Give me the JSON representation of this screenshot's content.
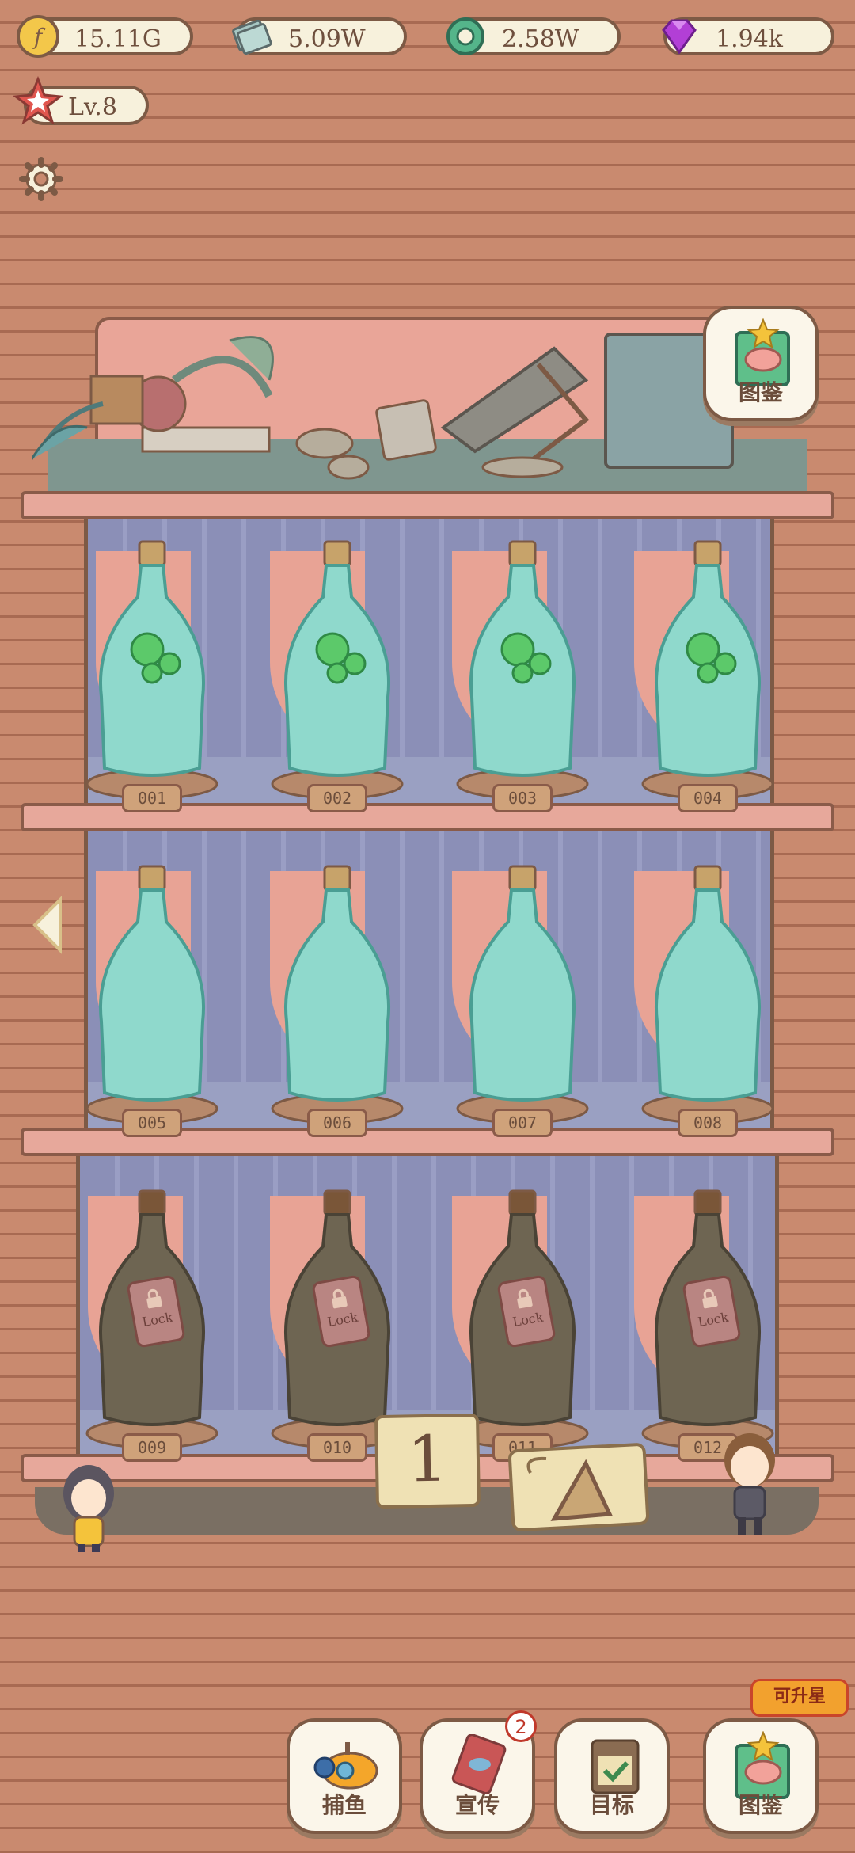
{
  "resources": {
    "gold": "15.11G",
    "cash": "5.09W",
    "gems_green": "2.58W",
    "diamonds": "1.94k"
  },
  "player": {
    "level": "Lv.8"
  },
  "collection_top_label": "图鉴",
  "bottles": [
    {
      "id": "001",
      "state": "filled"
    },
    {
      "id": "002",
      "state": "filled"
    },
    {
      "id": "003",
      "state": "filled"
    },
    {
      "id": "004",
      "state": "filled"
    },
    {
      "id": "005",
      "state": "empty"
    },
    {
      "id": "006",
      "state": "empty"
    },
    {
      "id": "007",
      "state": "empty"
    },
    {
      "id": "008",
      "state": "empty"
    },
    {
      "id": "009",
      "state": "locked"
    },
    {
      "id": "010",
      "state": "locked"
    },
    {
      "id": "011",
      "state": "locked"
    },
    {
      "id": "012",
      "state": "locked"
    }
  ],
  "lock_text": "Lock",
  "page_number": "1",
  "bottom_nav": {
    "fishing": "捕鱼",
    "promote": "宣传",
    "promote_badge": "2",
    "goals": "目标",
    "collection": "图鉴",
    "upgrade_tip": "可升星"
  },
  "colors": {
    "bottle_glass": "#8fd9cc",
    "locked_glass": "#6e6552",
    "fish_ball": "#5cc96a",
    "gem_purple": "#b23fd6",
    "accent_orange": "#f2a12e"
  }
}
